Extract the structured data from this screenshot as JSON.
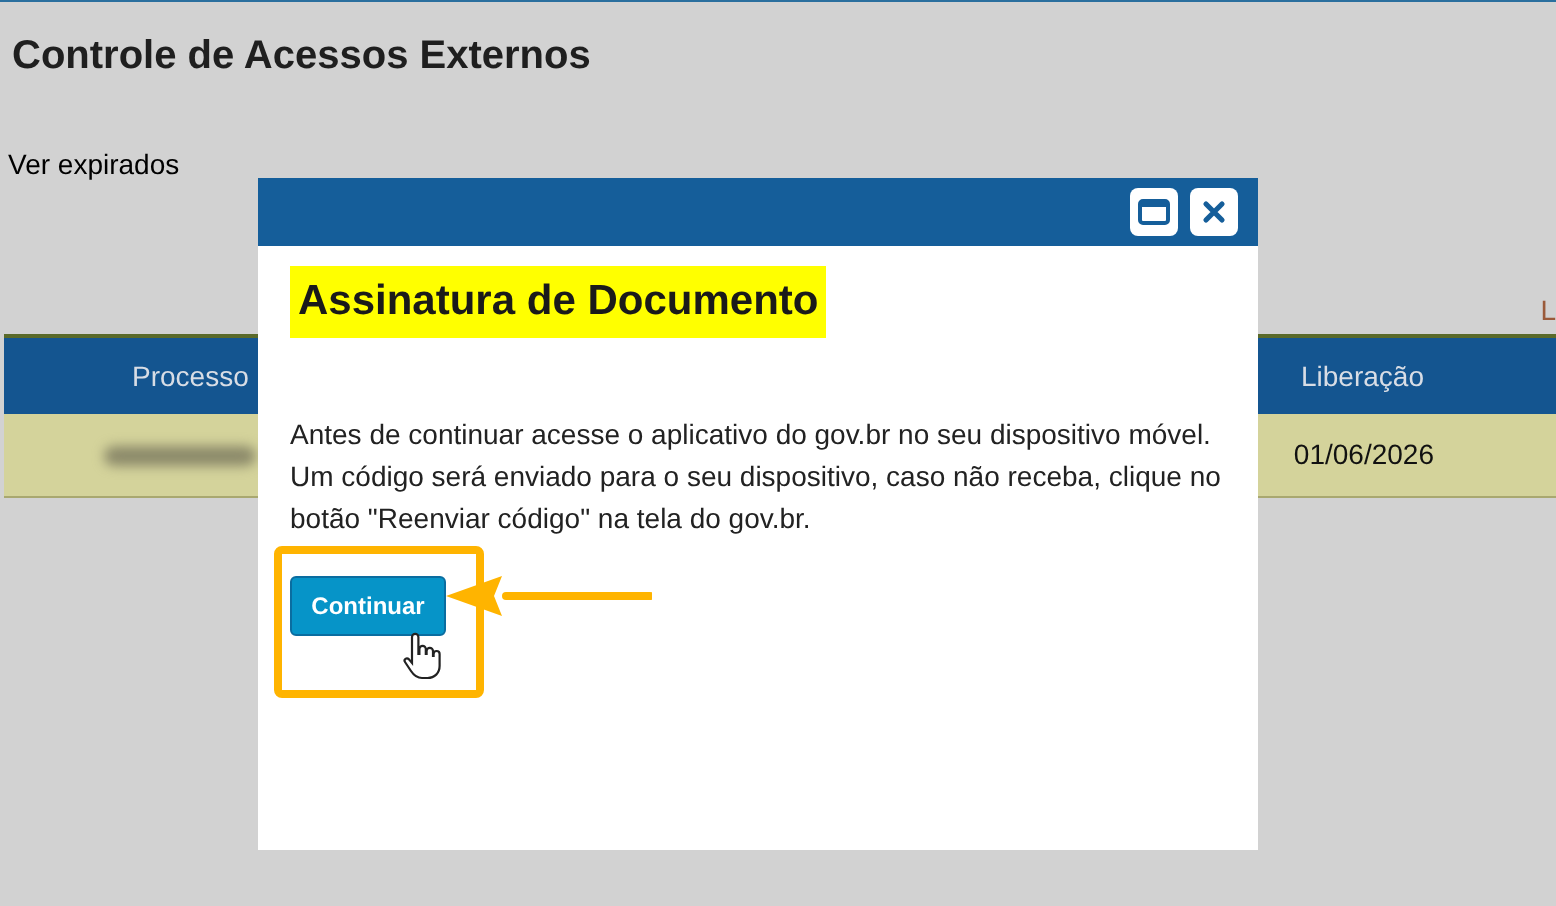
{
  "page": {
    "title": "Controle de Acessos Externos",
    "filter_link": "Ver expirados",
    "right_link": "L"
  },
  "table": {
    "columns": [
      "Processo",
      "Liberação"
    ],
    "rows": [
      {
        "liberacao": "01/06/2026"
      }
    ]
  },
  "dialog": {
    "title": "Assinatura de Documento",
    "message": "Antes de continuar acesse o aplicativo do gov.br no seu dispositivo móvel. Um código será enviado para o seu dispositivo, caso não receba, clique no botão \"Reenviar código\" na tela do gov.br.",
    "button": "Continuar"
  }
}
